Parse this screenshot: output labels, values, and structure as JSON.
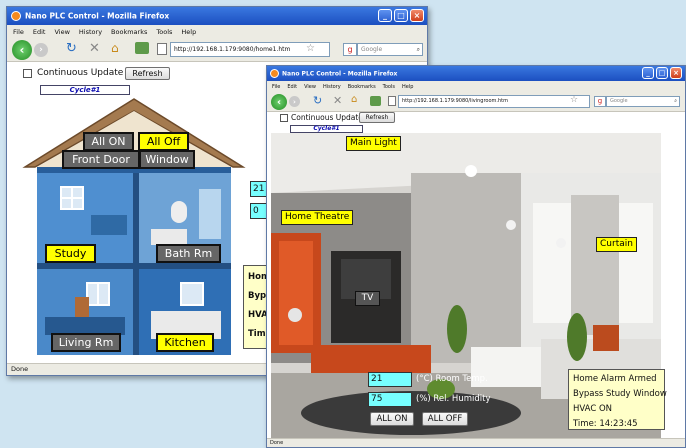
{
  "win1": {
    "title": "Nano PLC Control - Mozilla Firefox",
    "menu": [
      "File",
      "Edit",
      "View",
      "History",
      "Bookmarks",
      "Tools",
      "Help"
    ],
    "url": "http://192.168.1.179:9080/home1.htm",
    "search_placeholder": "Google",
    "continuous_update": "Continuous Update",
    "refresh": "Refresh",
    "cycle": "Cycle#1",
    "buttons": {
      "all_on": "All ON",
      "all_off": "All Off",
      "front_door": "Front Door",
      "window": "Window",
      "study": "Study",
      "bath": "Bath Rm",
      "living": "Living Rm",
      "kitchen": "Kitchen"
    },
    "readout_temp": "21",
    "readout_hum": "0",
    "panel_lines": [
      "Hom",
      "Byp",
      "HVA",
      "Tim"
    ],
    "status": "Done"
  },
  "win2": {
    "title": "Nano PLC Control - Mozilla Firefox",
    "menu": [
      "File",
      "Edit",
      "View",
      "History",
      "Bookmarks",
      "Tools",
      "Help"
    ],
    "url": "http://192.168.1.179:9080/livingroom.htm",
    "search_placeholder": "Google",
    "continuous_update": "Continuous Update",
    "refresh": "Refresh",
    "cycle": "Cycle#1",
    "labels": {
      "main_light": "Main Light",
      "home_theatre": "Home Theatre",
      "curtain": "Curtain",
      "tv": "TV"
    },
    "room_temp_value": "21",
    "room_temp_label": "(°C) Room Temp.",
    "humidity_value": "75",
    "humidity_label": "(%) Rel. Humidity",
    "all_on": "ALL ON",
    "all_off": "ALL OFF",
    "status_lines": [
      "Home Alarm Armed",
      "Bypass Study Window",
      "HVAC ON",
      "Time: 14:23:45"
    ],
    "status": "Done"
  }
}
